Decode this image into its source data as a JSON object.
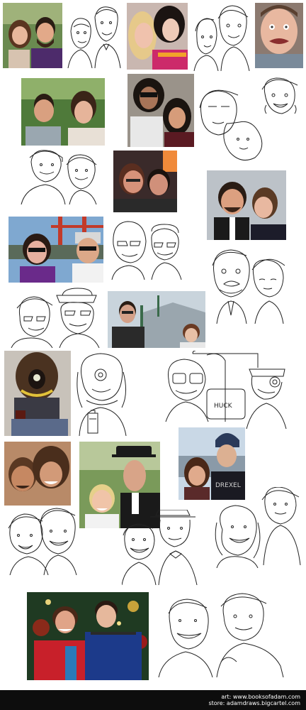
{
  "footer": {
    "line1": "art: www.booksofadam.com",
    "line2": "store: adamdraws.bigcartel.com"
  },
  "colors": {
    "background": "#ffffff",
    "footer": "#0d0d0d",
    "ink": "#222222"
  }
}
